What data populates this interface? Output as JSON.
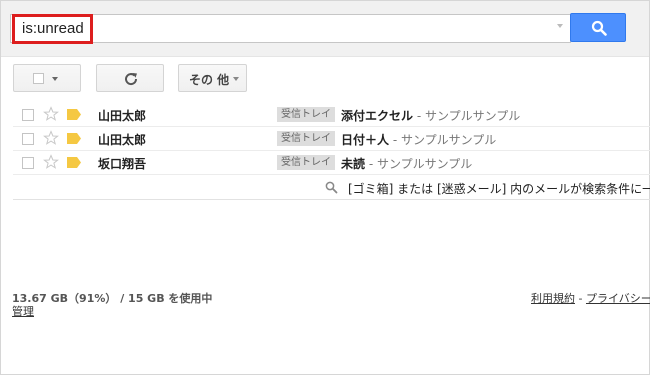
{
  "search": {
    "query": "is:unread"
  },
  "toolbar": {
    "more_label": "その 他"
  },
  "messages": [
    {
      "sender": "山田太郎",
      "label": "受信トレイ",
      "subject": "添付エクセル",
      "snippet": " - サンプルサンプル",
      "starred": false
    },
    {
      "sender": "山田太郎",
      "label": "受信トレイ",
      "subject": "日付＋人",
      "snippet": " - サンプルサンプル",
      "starred": false
    },
    {
      "sender": "坂口翔吾",
      "label": "受信トレイ",
      "subject": "未読",
      "snippet": " - サンプルサンプル",
      "starred": false
    }
  ],
  "search_note": "[ゴミ箱] または [迷惑メール] 内のメールが検索条件に一",
  "footer": {
    "storage": "13.67 GB（91%） / 15 GB を使用中",
    "manage": "管理",
    "terms": "利用規約",
    "separator": "-",
    "privacy": "プライバシー"
  },
  "colors": {
    "search_button": "#4d90fe",
    "highlight": "#dd1e1e",
    "important_marker": "#f5c842"
  }
}
